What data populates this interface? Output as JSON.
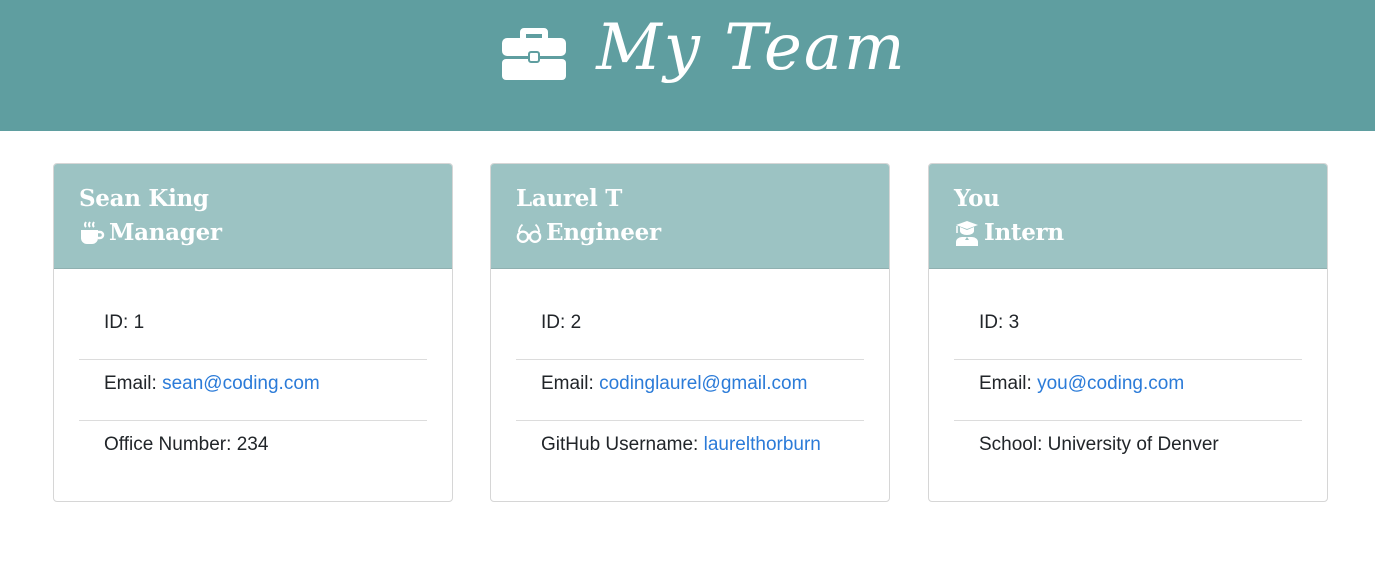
{
  "header": {
    "title": "My Team",
    "icon": "briefcase-icon",
    "background_color": "#5f9ea0"
  },
  "cards": [
    {
      "name": "Sean King",
      "role": "Manager",
      "role_icon": "coffee-icon",
      "items": [
        {
          "label": "ID: ",
          "value": "1"
        },
        {
          "label": "Email: ",
          "value": "sean@coding.com"
        },
        {
          "label": "Office Number: ",
          "value": "234"
        }
      ]
    },
    {
      "name": "Laurel T",
      "role": "Engineer",
      "role_icon": "glasses-icon",
      "items": [
        {
          "label": "ID: ",
          "value": "2"
        },
        {
          "label": "Email: ",
          "value": "codinglaurel@gmail.com"
        },
        {
          "label": "GitHub Username: ",
          "value": "laurelthorburn"
        }
      ]
    },
    {
      "name": "You",
      "role": "Intern",
      "role_icon": "graduate-icon",
      "items": [
        {
          "label": "ID: ",
          "value": "3"
        },
        {
          "label": "Email: ",
          "value": "you@coding.com"
        },
        {
          "label": "School: ",
          "value": "University of Denver"
        }
      ]
    }
  ],
  "colors": {
    "card_header": "#9cc3c3",
    "link": "#2b7bd8"
  }
}
